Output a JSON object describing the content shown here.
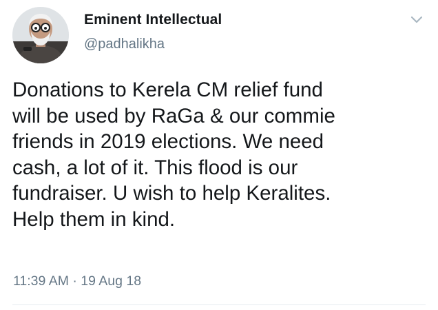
{
  "tweet": {
    "author": {
      "display_name": "Eminent Intellectual",
      "handle": "@padhalikha",
      "avatar_icon": "avatar-photo"
    },
    "menu_icon": "chevron-down-icon",
    "text": "Donations to Kerela CM relief fund\nwill be used by RaGa & our commie\nfriends in 2019 elections. We need\ncash, a lot of it. This flood is our\nfundraiser. U wish to help Keralites.\nHelp them in kind.",
    "timestamp": "11:39 AM · 19 Aug 18"
  },
  "colors": {
    "text_primary": "#14171a",
    "text_secondary": "#657786",
    "divider": "#e6ecf0",
    "caret": "#aab8c2"
  }
}
